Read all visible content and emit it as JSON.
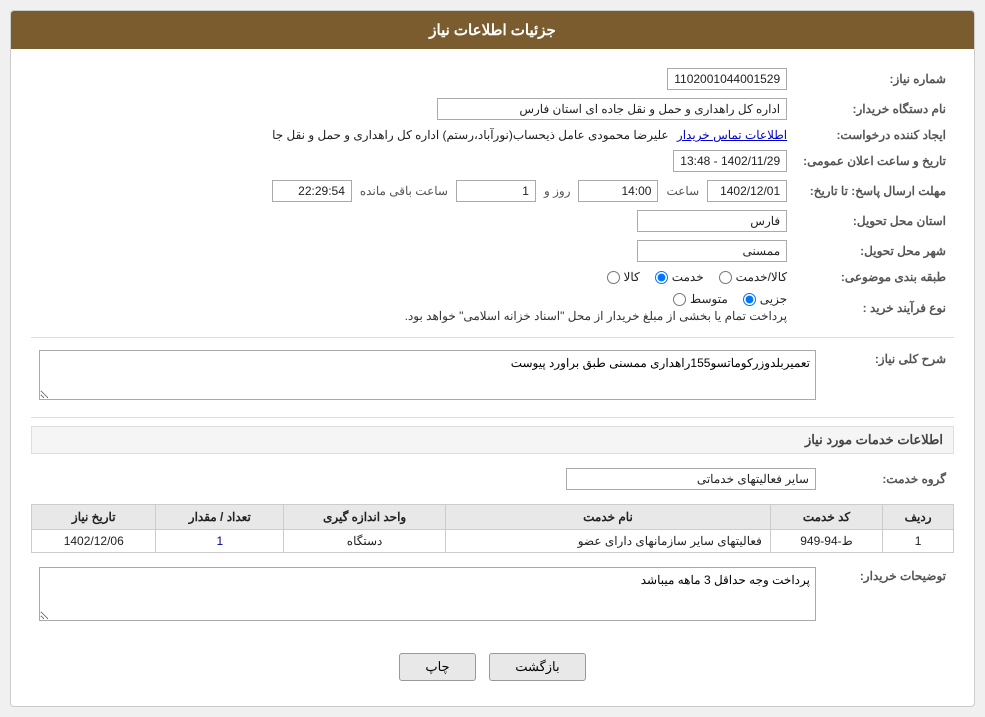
{
  "header": {
    "title": "جزئیات اطلاعات نیاز"
  },
  "fields": {
    "shomareNiaz_label": "شماره نیاز:",
    "shomareNiaz_value": "1102001044001529",
    "namDastgah_label": "نام دستگاه خریدار:",
    "namDastgah_value": "اداره کل راهداری و حمل و نقل جاده ای استان فارس",
    "ejadKonande_label": "ایجاد کننده درخواست:",
    "ejadKonande_value": "علیرضا محمودی عامل ذیحساب(نورآباد،رستم) اداره کل راهداری و حمل و نقل جا",
    "ejadKonande_link": "اطلاعات تماس خریدار",
    "tarikh_label": "تاریخ و ساعت اعلان عمومی:",
    "tarikh_value": "1402/11/29 - 13:48",
    "mohlat_label": "مهلت ارسال پاسخ: تا تاریخ:",
    "mohlat_date": "1402/12/01",
    "mohlat_saat_label": "ساعت",
    "mohlat_saat": "14:00",
    "mohlat_roz_label": "روز و",
    "mohlat_roz": "1",
    "mohlat_baghimande_label": "ساعت باقی مانده",
    "mohlat_baghimande": "22:29:54",
    "ostan_label": "استان محل تحویل:",
    "ostan_value": "فارس",
    "shahr_label": "شهر محل تحویل:",
    "shahr_value": "ممسنی",
    "tabaqe_label": "طبقه بندی موضوعی:",
    "tabaqe_options": [
      {
        "id": "kala",
        "label": "کالا"
      },
      {
        "id": "khadamat",
        "label": "خدمت"
      },
      {
        "id": "kala_khadamat",
        "label": "کالا/خدمت"
      }
    ],
    "tabaqe_selected": "khadamat",
    "noeFarayand_label": "نوع فرآیند خرید :",
    "noeFarayand_options": [
      {
        "id": "jozii",
        "label": "جزیی"
      },
      {
        "id": "motavasset",
        "label": "متوسط"
      },
      {
        "id": "description",
        "label": "پرداخت تمام یا بخشی از مبلغ خریدار از محل \"اسناد خزانه اسلامی\" خواهد بود."
      }
    ],
    "noeFarayand_selected": "jozii",
    "sharh_label": "شرح کلی نیاز:",
    "sharh_value": "تعمیربلدوزرکوماتسو155راهداری ممسنی طبق براورد پیوست",
    "services_label": "اطلاعات خدمات مورد نیاز",
    "group_label": "گروه خدمت:",
    "group_value": "سایر فعالیتهای خدماتی",
    "table_headers": [
      "ردیف",
      "کد خدمت",
      "نام خدمت",
      "واحد اندازه گیری",
      "تعداد / مقدار",
      "تاریخ نیاز"
    ],
    "table_rows": [
      {
        "radif": "1",
        "kod": "ط-94-949",
        "name": "فعالیتهای سایر سازمانهای دارای عضو",
        "vahed": "دستگاه",
        "tedad": "1",
        "tarikh": "1402/12/06"
      }
    ],
    "tozihat_label": "توضیحات خریدار:",
    "tozihat_value": "پرداخت وجه حداقل 3 ماهه میباشد"
  },
  "buttons": {
    "print_label": "چاپ",
    "back_label": "بازگشت"
  }
}
